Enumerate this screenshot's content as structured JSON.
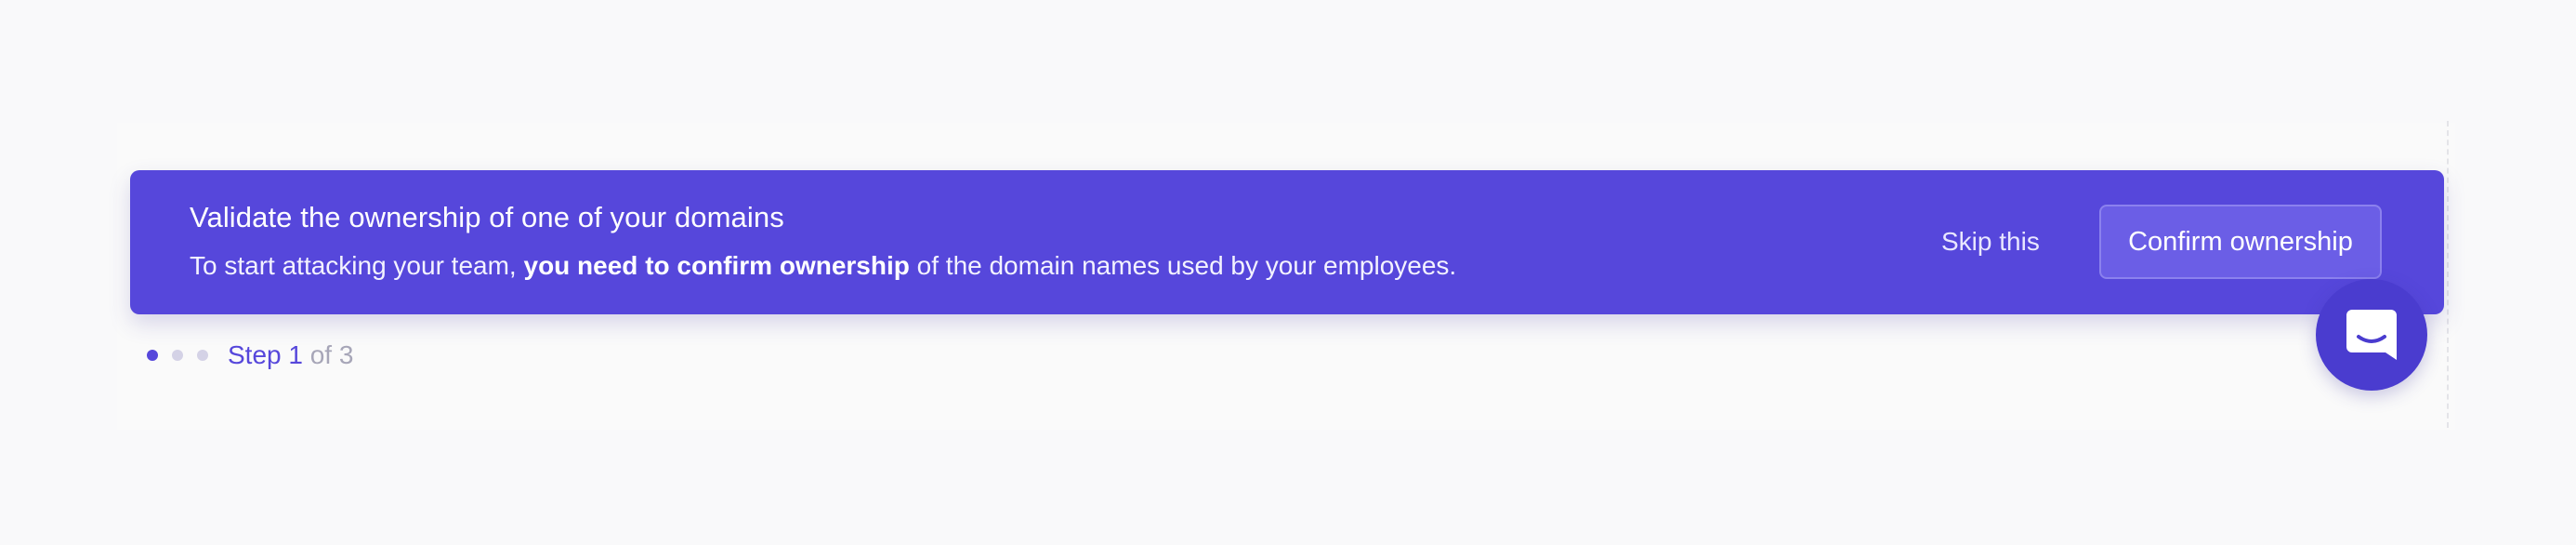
{
  "banner": {
    "title": "Validate the ownership of one of your domains",
    "desc_prefix": "To start attacking your team, ",
    "desc_bold": "you need to confirm ownership",
    "desc_suffix": " of the domain names used by your employees.",
    "skip_label": "Skip this",
    "confirm_label": "Confirm ownership"
  },
  "stepper": {
    "current_label": "Step 1",
    "total_label": " of 3",
    "steps": [
      {
        "state": "active"
      },
      {
        "state": "inactive"
      },
      {
        "state": "inactive"
      }
    ]
  },
  "chat": {
    "icon": "chat-icon"
  },
  "colors": {
    "accent": "#5647db",
    "background": "#f9f9fa",
    "muted": "#a7a6b8"
  }
}
